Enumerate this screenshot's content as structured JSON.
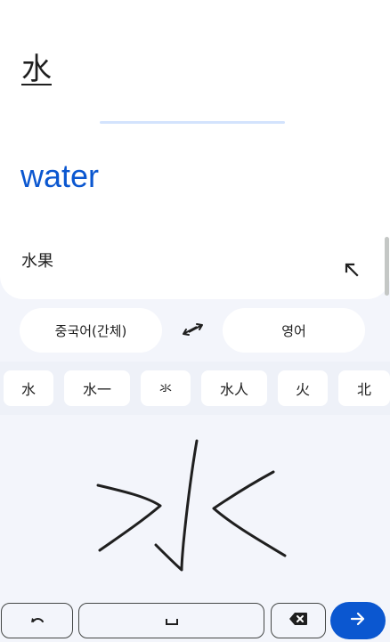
{
  "result_card": {
    "source_text": "水",
    "translation": "water",
    "suggestion": "水果"
  },
  "languages": {
    "source": "중국어(간체)",
    "target": "영어"
  },
  "candidates": [
    "水",
    "水一",
    "氺",
    "水人",
    "火",
    "北"
  ],
  "keyboard": {
    "undo_icon": "undo-icon",
    "space_icon": "space-icon",
    "backspace_icon": "backspace-icon",
    "enter_icon": "arrow-right-icon"
  },
  "colors": {
    "accent": "#0b57d0",
    "background": "#f3f5fb",
    "card": "#ffffff"
  }
}
